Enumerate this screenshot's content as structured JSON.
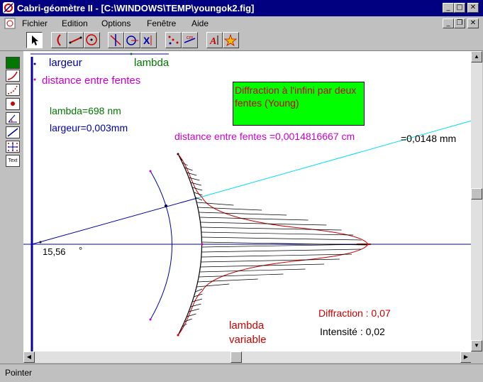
{
  "window": {
    "title": "Cabri-géomètre II - [C:\\WINDOWS\\TEMP\\youngok2.fig]"
  },
  "menu": [
    "Fichier",
    "Edition",
    "Options",
    "Fenêtre",
    "Aide"
  ],
  "toolbar": {
    "icons": [
      "pointer-icon",
      "curve-icon",
      "segment-icon",
      "circle-icon",
      "perpendicular-icon",
      "compass-icon",
      "reflection-icon",
      "locus-icon",
      "measure-icon",
      "text-icon",
      "appearance-icon"
    ]
  },
  "left_tools": {
    "icons": [
      "color-swatch",
      "curve-style",
      "dotted-style",
      "point-style",
      "angle-style",
      "line-style",
      "grid-icon",
      "text-style"
    ],
    "text_label": "Text"
  },
  "canvas": {
    "label_largeur": "largeur",
    "label_lambda": "lambda",
    "label_distance": "distance entre fentes",
    "lambda_value": "lambda=698 nm",
    "largeur_value": "largeur=0,003mm",
    "box_title": "Diffraction à l'infini par deux fentes (Young)",
    "distance_value": "distance entre fentes =0,0014816667 cm",
    "mm_value": "=0,0148 mm",
    "angle_value": "15,56",
    "angle_unit": "°",
    "diffraction": "Diffraction : 0,07",
    "intensite": "Intensité : 0,02",
    "lambda_variable": "lambda variable"
  },
  "colors": {
    "title_bg": "#000080",
    "box_green": "#00ff00",
    "red": "#cc0000",
    "magenta": "#cc00cc",
    "blue": "#0000aa",
    "cyan": "#00ddee",
    "green": "#007700"
  },
  "status": {
    "text": "Pointer"
  }
}
